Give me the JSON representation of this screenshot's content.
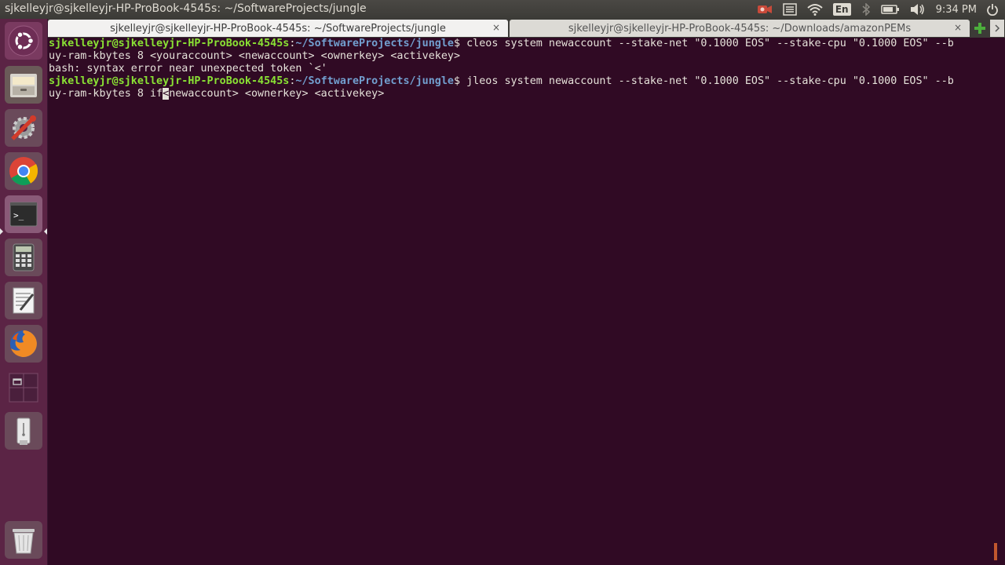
{
  "panel": {
    "window_title": "sjkelleyjr@sjkelleyjr-HP-ProBook-4545s: ~/SoftwareProjects/jungle",
    "keyboard_layout": "En",
    "clock": "9:34 PM",
    "indicator_icons": [
      "record-icon",
      "menu-icon",
      "wifi-icon",
      "keyboard-icon",
      "bluetooth-icon",
      "battery-icon",
      "volume-icon",
      "power-icon"
    ]
  },
  "launcher": {
    "items": [
      {
        "name": "ubuntu-dash-icon"
      },
      {
        "name": "files-icon"
      },
      {
        "name": "system-settings-icon"
      },
      {
        "name": "chrome-icon"
      },
      {
        "name": "terminal-icon"
      },
      {
        "name": "calculator-icon"
      },
      {
        "name": "text-editor-icon"
      },
      {
        "name": "firefox-icon"
      },
      {
        "name": "workspace-switcher-icon"
      },
      {
        "name": "usb-drive-icon"
      },
      {
        "name": "trash-icon"
      }
    ]
  },
  "tabs": [
    {
      "label": "sjkelleyjr@sjkelleyjr-HP-ProBook-4545s: ~/SoftwareProjects/jungle",
      "active": true,
      "close": "×"
    },
    {
      "label": "sjkelleyjr@sjkelleyjr-HP-ProBook-4545s: ~/Downloads/amazonPEMs",
      "active": false,
      "close": "×"
    }
  ],
  "terminal": {
    "line1": {
      "user": "sjkelleyjr@sjkelleyjr-HP-ProBook-4545s",
      "sep": ":",
      "path": "~/SoftwareProjects/jungle",
      "dollar": "$ ",
      "command": "cleos system newaccount --stake-net \"0.1000 EOS\" --stake-cpu \"0.1000 EOS\" --b"
    },
    "line2": "uy-ram-kbytes 8 <youraccount> <newaccount> <ownerkey> <activekey>",
    "line3": "bash: syntax error near unexpected token `<'",
    "line4": {
      "user": "sjkelleyjr@sjkelleyjr-HP-ProBook-4545s",
      "sep": ":",
      "path": "~/SoftwareProjects/jungle",
      "dollar": "$ ",
      "command": "jleos system newaccount --stake-net \"0.1000 EOS\" --stake-cpu \"0.1000 EOS\" --b"
    },
    "line5": {
      "before": "uy-ram-kbytes 8 if",
      "cursor": "<",
      "after": "newaccount> <ownerkey> <activekey>"
    }
  },
  "colors": {
    "terminal_bg": "#300a24",
    "prompt_user": "#8ae234",
    "prompt_path": "#729fcf",
    "launcher_bg": "#5b2445",
    "panel_bg": "#3c3b37"
  }
}
